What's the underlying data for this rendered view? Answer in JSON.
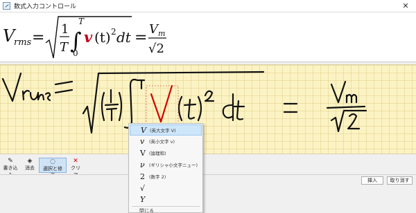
{
  "window": {
    "title": "数式入力コントロール",
    "close_glyph": "✕"
  },
  "preview": {
    "formula_lhs_base": "V",
    "formula_lhs_sub": "rms",
    "equals": "=",
    "frac_num": "1",
    "frac_den": "T",
    "integral_sign": "∫",
    "upper_limit": "T",
    "lower_limit": "0",
    "var_v": "v",
    "argument": "(t)",
    "exponent": "2",
    "differential": "dt",
    "rhs_num_base": "V",
    "rhs_num_sub": "m",
    "rhs_den": "√2",
    "highlight_color": "#c0001a"
  },
  "ink": {
    "stroke_color": "#111111",
    "selected_stroke_color": "#d40000",
    "dash_box_color": "#d06060"
  },
  "toolbar": {
    "write_label": "書き込み",
    "erase_label": "消去",
    "select_label": "選択と修正",
    "clear_label": "クリア",
    "active_tool": "選択と修正"
  },
  "footer": {
    "insert_label": "挿入",
    "cancel_label": "取り消す"
  },
  "menu": {
    "items": [
      {
        "glyph": "V",
        "desc": "(英大文字 V)",
        "selected": true
      },
      {
        "glyph": "v",
        "desc": "(英小文字 v)",
        "selected": false
      },
      {
        "glyph": "V",
        "desc": "(論理和)",
        "selected": false
      },
      {
        "glyph": "ν",
        "desc": "(ギリシャ小文字ニュー)",
        "selected": false
      },
      {
        "glyph": "2",
        "desc": "(数字 2)",
        "selected": false
      },
      {
        "glyph": "√",
        "desc": "",
        "selected": false
      },
      {
        "glyph": "Y",
        "desc": "",
        "selected": false
      }
    ],
    "close_label": "閉じる"
  }
}
